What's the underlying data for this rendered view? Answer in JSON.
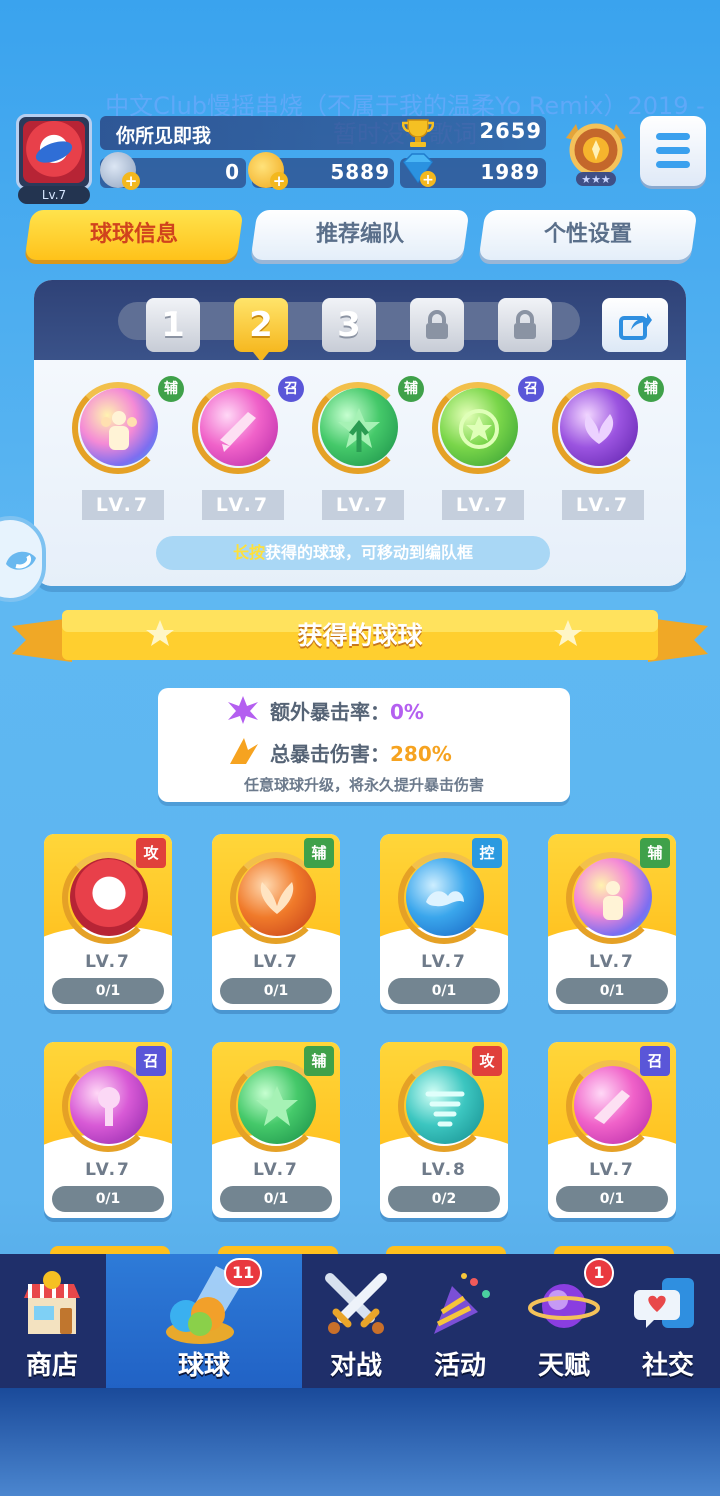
{
  "overlay_song": "中文Club慢摇串烧（不属于我的温柔Yo Remix）2019 - 暂时没有歌词",
  "player": {
    "name": "你所见即我",
    "level": "Lv.7",
    "trophies": "2659",
    "res1": "0",
    "coins": "5889",
    "gems": "1989"
  },
  "tabs": [
    "球球信息",
    "推荐编队",
    "个性设置"
  ],
  "team": {
    "slots": [
      "1",
      "2",
      "3"
    ],
    "balls": [
      {
        "role": "辅",
        "level": "LV.7"
      },
      {
        "role": "召",
        "level": "LV.7"
      },
      {
        "role": "辅",
        "level": "LV.7"
      },
      {
        "role": "召",
        "level": "LV.7"
      },
      {
        "role": "辅",
        "level": "LV.7"
      }
    ],
    "hint_em": "长按",
    "hint": "获得的球球，可移动到编队框"
  },
  "section_title": "获得的球球",
  "crit": {
    "label1": "额外暴击率：",
    "value1": "0%",
    "label2": "总暴击伤害：",
    "value2": "280%",
    "hint": "任意球球升级，将永久提升暴击伤害"
  },
  "cards": [
    {
      "tag": "攻",
      "level": "LV.7",
      "count": "0/1"
    },
    {
      "tag": "辅",
      "level": "LV.7",
      "count": "0/1"
    },
    {
      "tag": "控",
      "level": "LV.7",
      "count": "0/1"
    },
    {
      "tag": "辅",
      "level": "LV.7",
      "count": "0/1"
    },
    {
      "tag": "召",
      "level": "LV.7",
      "count": "0/1"
    },
    {
      "tag": "辅",
      "level": "LV.7",
      "count": "0/1"
    },
    {
      "tag": "攻",
      "level": "LV.8",
      "count": "0/2"
    },
    {
      "tag": "召",
      "level": "LV.7",
      "count": "0/1"
    }
  ],
  "nav": [
    {
      "label": "商店",
      "badge": ""
    },
    {
      "label": "球球",
      "badge": "11"
    },
    {
      "label": "对战",
      "badge": ""
    },
    {
      "label": "活动",
      "badge": ""
    },
    {
      "label": "天赋",
      "badge": "1"
    },
    {
      "label": "社交",
      "badge": ""
    }
  ],
  "colors": {
    "background": "#5fb8f2",
    "tab_active": "#ffc21a",
    "tag_attack": "#e0403b",
    "tag_support": "#3fa14a",
    "tag_control": "#2a9ae0",
    "tag_summon": "#5a56d8",
    "nav_bg": "#1f2f6a"
  }
}
